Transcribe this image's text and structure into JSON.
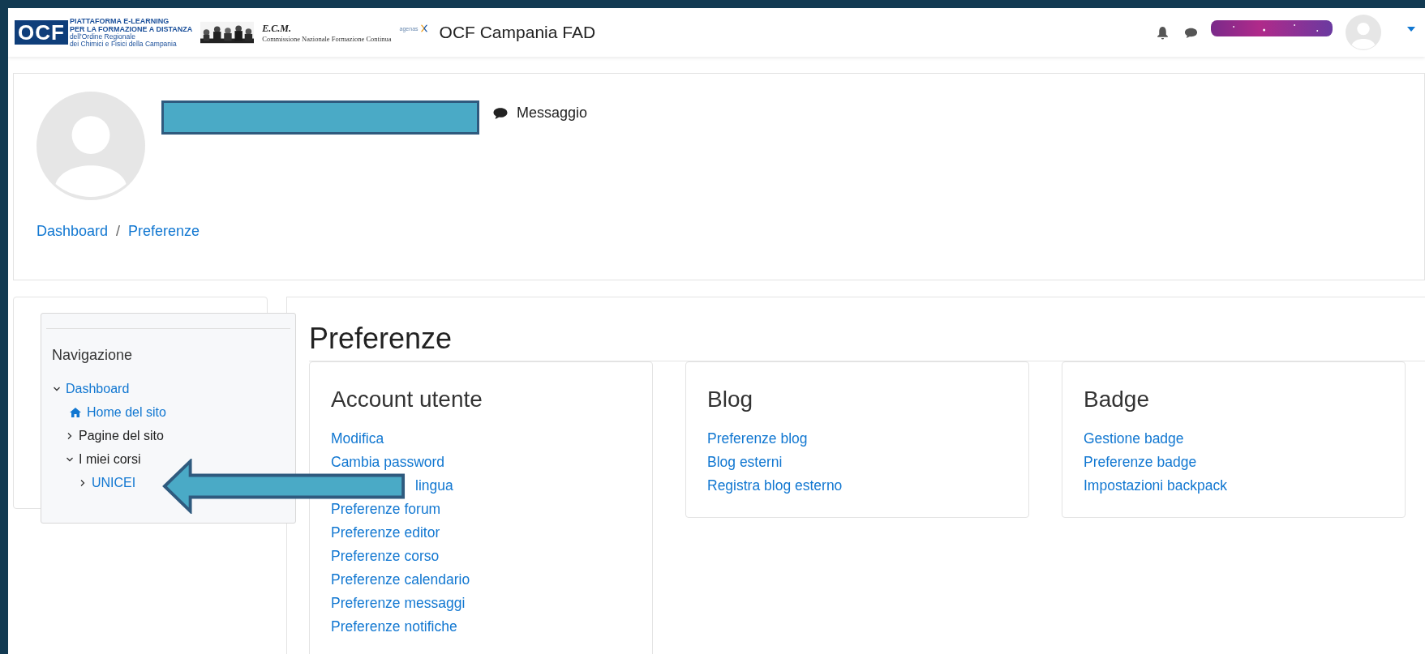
{
  "header": {
    "logo": {
      "mark": "OCF",
      "line_1": "PIATTAFORMA E-LEARNING",
      "line_2": "PER LA FORMAZIONE A DISTANZA",
      "line_3": "dell'Ordine Regionale",
      "line_4": "dei Chimici e Fisici della Campania"
    },
    "ecm": {
      "mark": "E.C.M.",
      "subtitle": "Commissione Nazionale Formazione Continua"
    },
    "agency": "agenas",
    "site_title": "OCF Campania FAD"
  },
  "profile": {
    "message_label": "Messaggio"
  },
  "breadcrumb": {
    "separator": "/",
    "items": [
      {
        "label": "Dashboard"
      },
      {
        "label": "Preferenze"
      }
    ]
  },
  "navigation": {
    "title": "Navigazione",
    "items": [
      {
        "label": "Dashboard",
        "kind": "link",
        "expanded": true,
        "children": [
          {
            "label": "Home del sito",
            "kind": "home"
          },
          {
            "label": "Pagine del sito",
            "kind": "text",
            "expanded": false
          },
          {
            "label": "I miei corsi",
            "kind": "text",
            "expanded": true,
            "children": [
              {
                "label": "UNICEI",
                "kind": "link",
                "expanded": false
              }
            ]
          }
        ]
      }
    ]
  },
  "page_title": "Preferenze",
  "cards": [
    {
      "title": "Account utente",
      "links": [
        {
          "label": "Modifica",
          "kind": "full"
        },
        {
          "label": "Cambia password",
          "kind": "full"
        },
        {
          "label": "lingua",
          "kind": "partial"
        },
        {
          "label": "Preferenze forum",
          "kind": "full"
        },
        {
          "label": "Preferenze editor",
          "kind": "full"
        },
        {
          "label": "Preferenze corso",
          "kind": "full"
        },
        {
          "label": "Preferenze calendario",
          "kind": "full"
        },
        {
          "label": "Preferenze messaggi",
          "kind": "full"
        },
        {
          "label": "Preferenze notifiche",
          "kind": "full"
        }
      ]
    },
    {
      "title": "Blog",
      "links": [
        {
          "label": "Preferenze blog",
          "kind": "full"
        },
        {
          "label": "Blog esterni",
          "kind": "full"
        },
        {
          "label": "Registra blog esterno",
          "kind": "full"
        }
      ]
    },
    {
      "title": "Badge",
      "links": [
        {
          "label": "Gestione badge",
          "kind": "full"
        },
        {
          "label": "Preferenze badge",
          "kind": "full"
        },
        {
          "label": "Impostazioni backpack",
          "kind": "full"
        }
      ]
    }
  ]
}
